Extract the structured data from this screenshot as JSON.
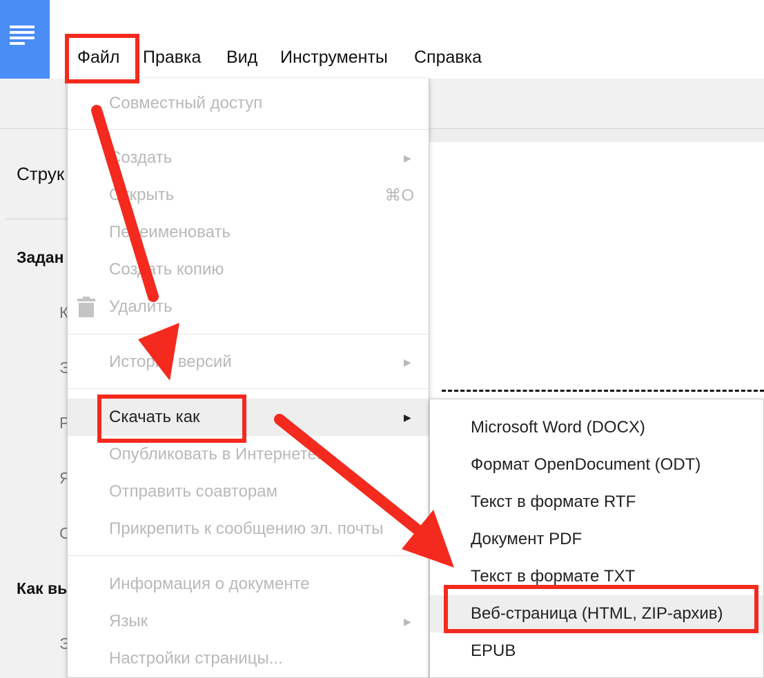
{
  "menubar": {
    "items": [
      "Файл",
      "Правка",
      "Вид",
      "Инструменты",
      "Справка"
    ]
  },
  "outline": {
    "title_partial": "Струк",
    "heading1_partial": "Задан",
    "heading2_partial": "Как вы",
    "fragments": [
      "К",
      "Э",
      "Р",
      "Я",
      "С",
      "Э"
    ]
  },
  "file_menu": {
    "items": [
      {
        "label": "Совместный доступ"
      },
      {
        "label": "Создать",
        "submenu": true
      },
      {
        "label": "Открыть",
        "shortcut": "⌘O"
      },
      {
        "label": "Переименовать"
      },
      {
        "label": "Создать копию"
      },
      {
        "label": "Удалить",
        "icon": "trash-icon"
      },
      {
        "label": "История версий",
        "submenu": true
      },
      {
        "label": "Скачать как",
        "submenu": true,
        "active": true
      },
      {
        "label": "Опубликовать в Интернете..."
      },
      {
        "label": "Отправить соавторам"
      },
      {
        "label": "Прикрепить к сообщению эл. почты"
      },
      {
        "label": "Информация о документе"
      },
      {
        "label": "Язык",
        "submenu": true
      },
      {
        "label": "Настройки страницы..."
      }
    ]
  },
  "download_submenu": {
    "items": [
      "Microsoft Word (DOCX)",
      "Формат OpenDocument (ODT)",
      "Текст в формате RTF",
      "Документ PDF",
      "Текст в формате TXT",
      "Веб-страница (HTML, ZIP-архив)",
      "EPUB"
    ]
  },
  "colors": {
    "accent_blue": "#4a8df5",
    "annotation_red": "#f52a1e",
    "disabled_text": "#b9b9b9"
  }
}
